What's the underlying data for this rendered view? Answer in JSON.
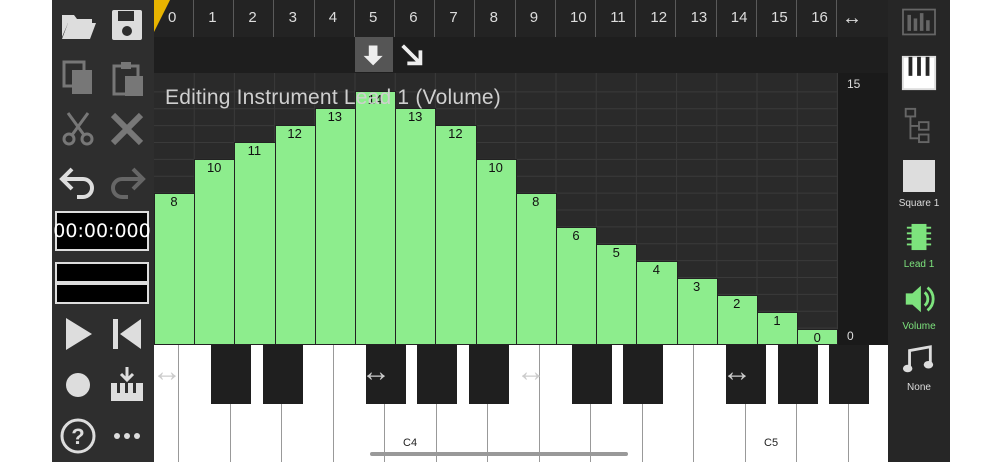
{
  "time": "00:00:000",
  "edit_title": "Editing Instrument Lead 1 (Volume)",
  "ruler": [
    "0",
    "1",
    "2",
    "3",
    "4",
    "5",
    "6",
    "7",
    "8",
    "9",
    "10",
    "11",
    "12",
    "13",
    "14",
    "15",
    "16"
  ],
  "volume_values": [
    8,
    10,
    11,
    12,
    13,
    14,
    13,
    12,
    10,
    8,
    6,
    5,
    4,
    3,
    2,
    1,
    0
  ],
  "scale": {
    "max": "15",
    "min": "0"
  },
  "octaves": [
    "C4",
    "C5"
  ],
  "right_panel": {
    "square": "Square 1",
    "lead": "Lead 1",
    "volume": "Volume",
    "none": "None"
  },
  "colors": {
    "bar": "#8ded8d",
    "active": "#7de37d"
  },
  "icons": [
    "folder-open-icon",
    "save-icon",
    "copy-icon",
    "paste-icon",
    "cut-icon",
    "delete-icon",
    "undo-icon",
    "redo-icon",
    "play-icon",
    "skip-back-icon",
    "record-icon",
    "keyboard-insert-icon",
    "help-icon",
    "more-icon"
  ]
}
